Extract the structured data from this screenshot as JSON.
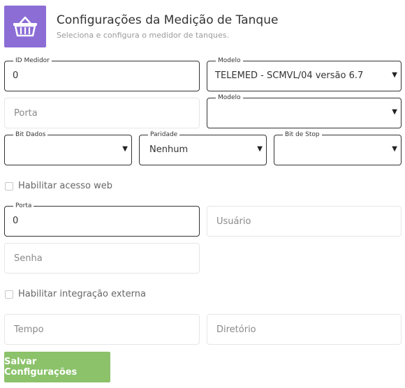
{
  "header": {
    "icon": "basket-icon",
    "title": "Configurações da Medição de Tanque",
    "subtitle": "Seleciona e configura o medidor de tanques."
  },
  "fields": {
    "id_medidor": {
      "label": "ID Medidor",
      "value": "0"
    },
    "modelo1": {
      "label": "Modelo",
      "value": "TELEMED - SCMVL/04 versão 6.7"
    },
    "porta1": {
      "placeholder": "Porta"
    },
    "modelo2": {
      "label": "Modelo",
      "value": ""
    },
    "bit_dados": {
      "label": "Bit Dados",
      "value": ""
    },
    "paridade": {
      "label": "Paridade",
      "value": "Nenhum"
    },
    "bit_stop": {
      "label": "Bit de Stop",
      "value": ""
    },
    "porta2": {
      "label": "Porta",
      "value": "0"
    },
    "usuario": {
      "placeholder": "Usuário"
    },
    "senha": {
      "placeholder": "Senha"
    },
    "tempo": {
      "placeholder": "Tempo"
    },
    "diretorio": {
      "placeholder": "Diretório"
    }
  },
  "checkboxes": {
    "web_access": {
      "label": "Habilitar acesso web",
      "checked": false
    },
    "external_integration": {
      "label": "Habilitar integração externa",
      "checked": false
    }
  },
  "actions": {
    "save_label": "Salvar Configurações"
  },
  "colors": {
    "accent_purple": "#8c6dd6",
    "save_green": "#8bc26a"
  }
}
